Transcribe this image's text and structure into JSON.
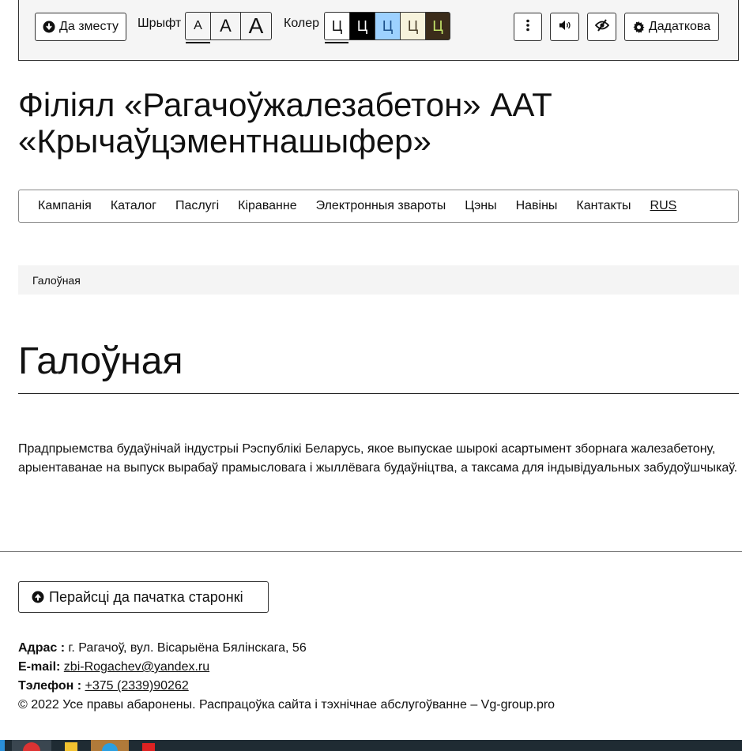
{
  "toolbar": {
    "skip_label": "Да зместу",
    "font_label": "Шрыфт",
    "font_sizes": [
      "A",
      "A",
      "A"
    ],
    "color_label": "Колер",
    "color_swatches": [
      {
        "glyph": "Ц",
        "bg": "#ffffff",
        "fg": "#111111"
      },
      {
        "glyph": "Ц",
        "bg": "#000000",
        "fg": "#ffffff"
      },
      {
        "glyph": "Ц",
        "bg": "#9dd1ff",
        "fg": "#1b4f8a"
      },
      {
        "glyph": "Ц",
        "bg": "#f7f3dc",
        "fg": "#4a3f2a"
      },
      {
        "glyph": "Ц",
        "bg": "#3b2c1a",
        "fg": "#c6e86b"
      }
    ],
    "more_icon": "vertical-dots-icon",
    "sound_icon": "speaker-icon",
    "images_icon": "eye-slash-icon",
    "extra_label": "Дадаткова"
  },
  "site": {
    "title_line1": "Філіял «Рагачоўжалезабетон» ААТ",
    "title_line2": "«Крычаўцэментнашыфер»"
  },
  "nav": {
    "items": [
      "Кампанія",
      "Каталог",
      "Паслугі",
      "Кіраванне",
      "Электронныя звароты",
      "Цэны",
      "Навіны",
      "Кантакты"
    ],
    "lang": "RUS"
  },
  "breadcrumb": "Галоўная",
  "page": {
    "title": "Галоўная",
    "intro": "Прадпрыемства будаўнічай індустрыі Рэспублікі Беларусь, якое выпускае шырокі асартымент зборнага жалезабетону, арыентаванае на выпуск вырабаў прамысловага і жыллёвага будаўніцтва, а таксама для індывідуальных забудоўшчыкаў."
  },
  "footer": {
    "to_top": "Перайсці да пачатка старонкі",
    "address_label": "Адрас :",
    "address": " г. Рагачоў, вул. Вісарыёна Бялінскага, 56",
    "email_label": "E-mail:",
    "email": "zbi-Rogachev@yandex.ru",
    "phone_label": "Тэлефон :",
    "phone": "+375 (2339)90262",
    "copyright": "© 2022 Усе правы абаронены. Распрацоўка сайта і тэхнічнае абслугоўванне – Vg-group.pro"
  }
}
